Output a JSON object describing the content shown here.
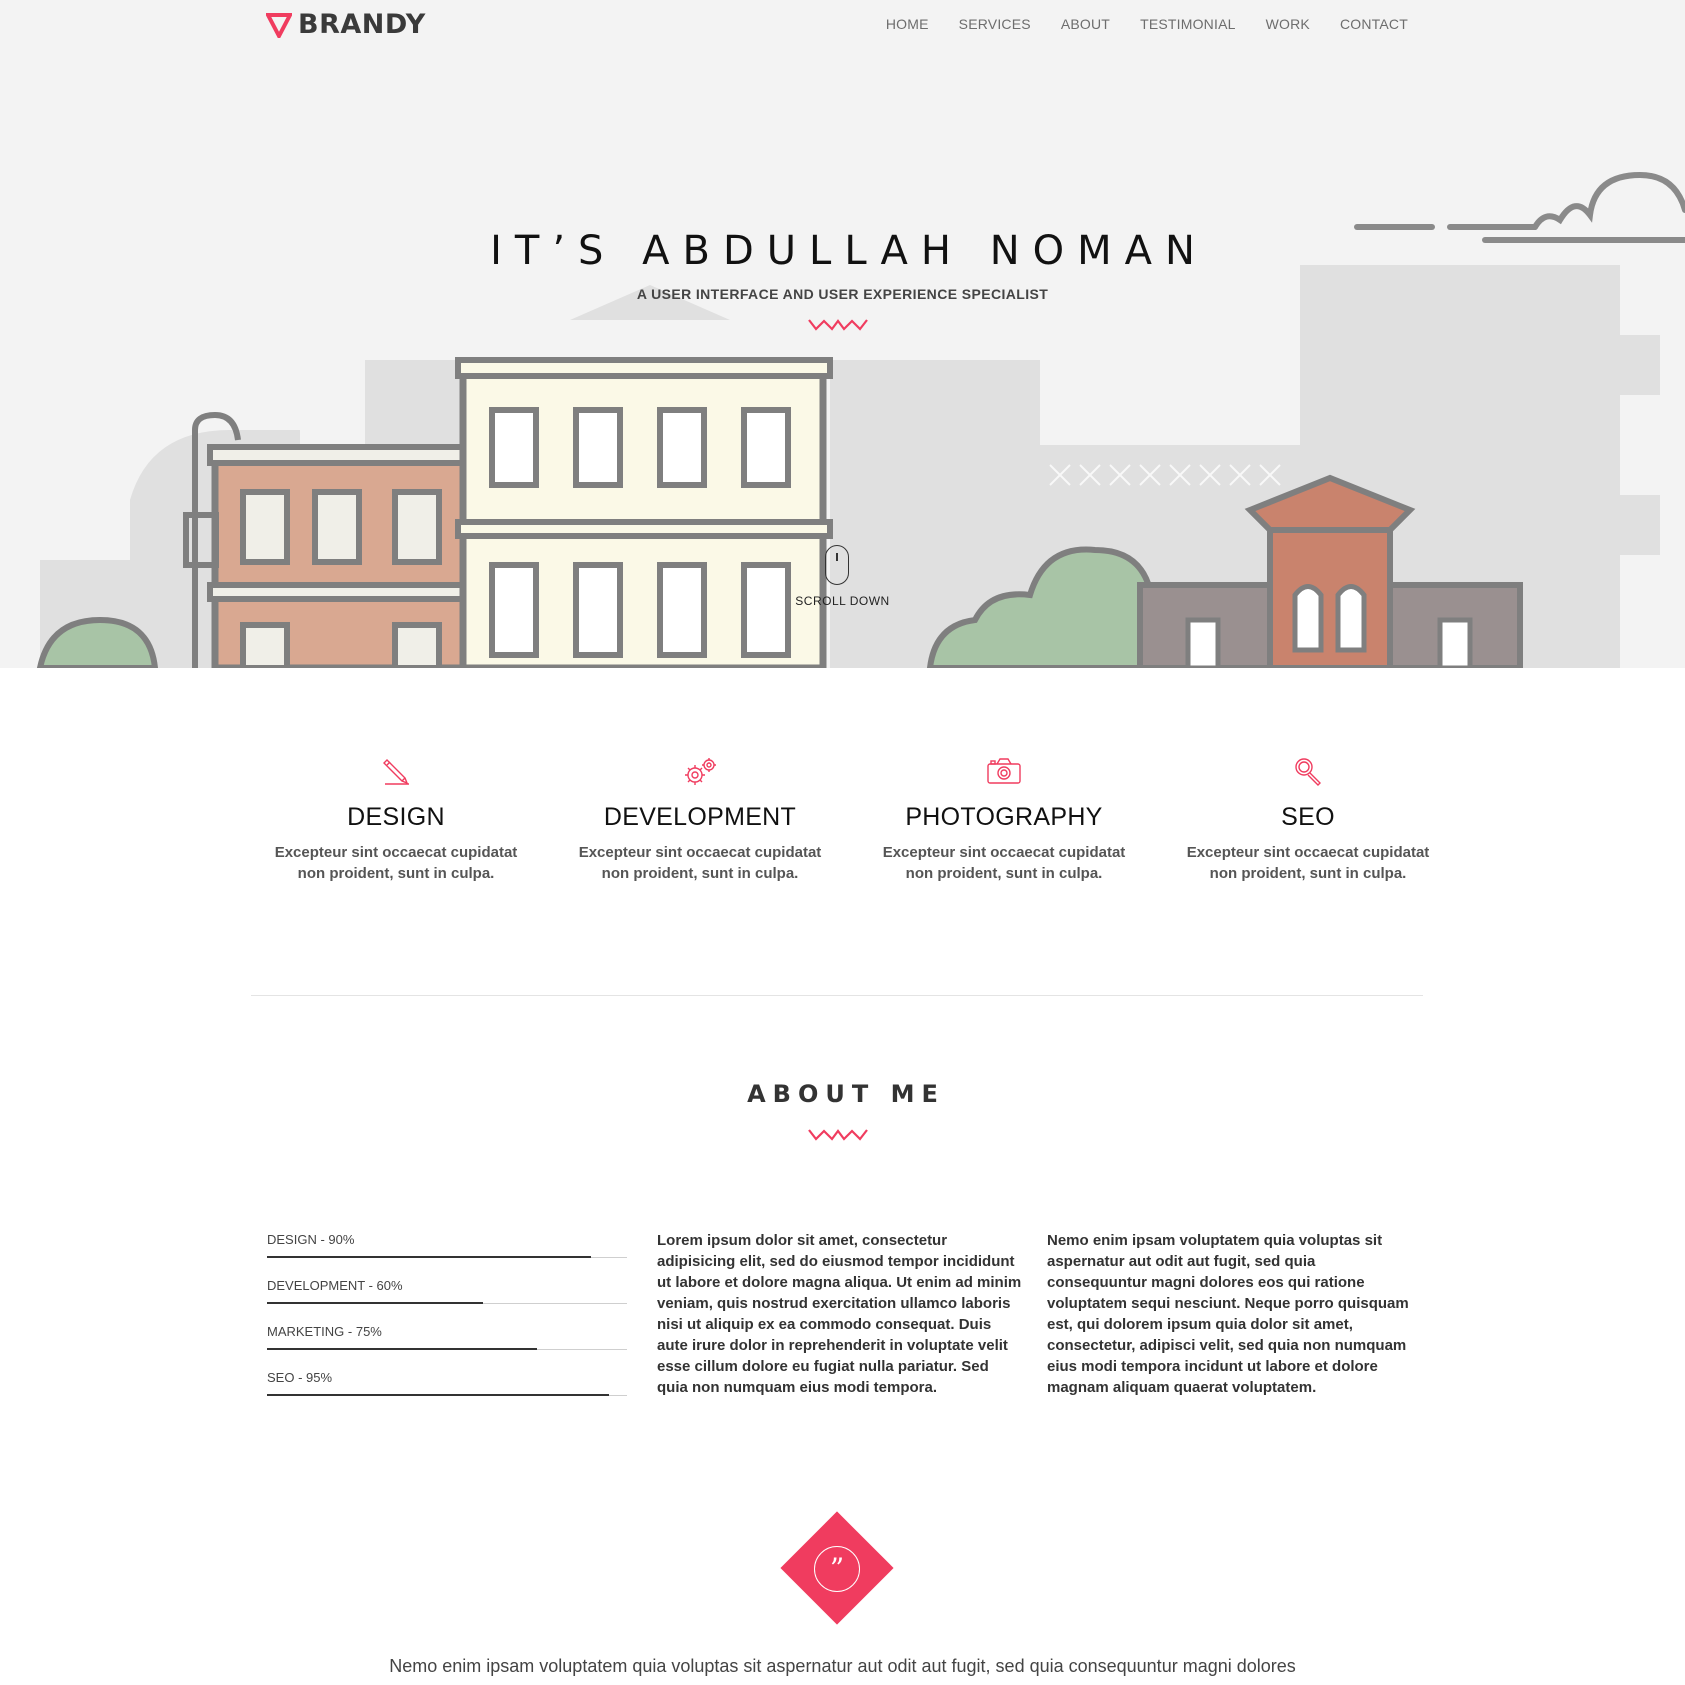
{
  "brand": {
    "name": "BRANDY",
    "accent": "#f03c5f"
  },
  "nav": {
    "items": [
      "HOME",
      "SERVICES",
      "ABOUT",
      "TESTIMONIAL",
      "WORK",
      "CONTACT"
    ]
  },
  "hero": {
    "title": "IT’S ABDULLAH NOMAN",
    "subtitle": "A USER INTERFACE AND USER EXPERIENCE SPECIALIST",
    "scroll_label": "SCROLL DOWN"
  },
  "services": [
    {
      "icon": "pencil-icon",
      "title": "DESIGN",
      "text": "Excepteur sint occaecat cupidatat non proident, sunt in culpa."
    },
    {
      "icon": "gears-icon",
      "title": "DEVELOPMENT",
      "text": "Excepteur sint occaecat cupidatat non proident, sunt in culpa."
    },
    {
      "icon": "camera-icon",
      "title": "PHOTOGRAPHY",
      "text": "Excepteur sint occaecat cupidatat non proident, sunt in culpa."
    },
    {
      "icon": "magnifier-icon",
      "title": "SEO",
      "text": "Excepteur sint occaecat cupidatat non proident, sunt in culpa."
    }
  ],
  "about": {
    "title": "ABOUT ME",
    "skills": [
      {
        "label": "DESIGN - 90%",
        "percent": 90
      },
      {
        "label": "DEVELOPMENT - 60%",
        "percent": 60
      },
      {
        "label": "MARKETING - 75%",
        "percent": 75
      },
      {
        "label": "SEO - 95%",
        "percent": 95
      }
    ],
    "col1": "Lorem ipsum dolor sit amet, consectetur adipisicing elit, sed do eiusmod tempor incididunt ut labore et dolore magna aliqua. Ut enim ad minim veniam, quis nostrud exercitation ullamco laboris nisi ut aliquip ex ea commodo consequat. Duis aute irure dolor in reprehenderit in voluptate velit esse cillum dolore eu fugiat nulla pariatur. Sed quia non numquam eius modi tempora.",
    "col2": "Nemo enim ipsam voluptatem quia voluptas sit aspernatur aut odit aut fugit, sed quia consequuntur magni dolores eos qui ratione voluptatem sequi nesciunt. Neque porro quisquam est, qui dolorem ipsum quia dolor sit amet, consectetur, adipisci velit, sed quia non numquam eius modi tempora incidunt ut labore et dolore magnam aliquam quaerat voluptatem."
  },
  "testimonial": {
    "quote_glyph": "”",
    "text": "Nemo enim ipsam voluptatem quia voluptas sit aspernatur aut odit aut fugit, sed quia consequuntur magni dolores"
  }
}
